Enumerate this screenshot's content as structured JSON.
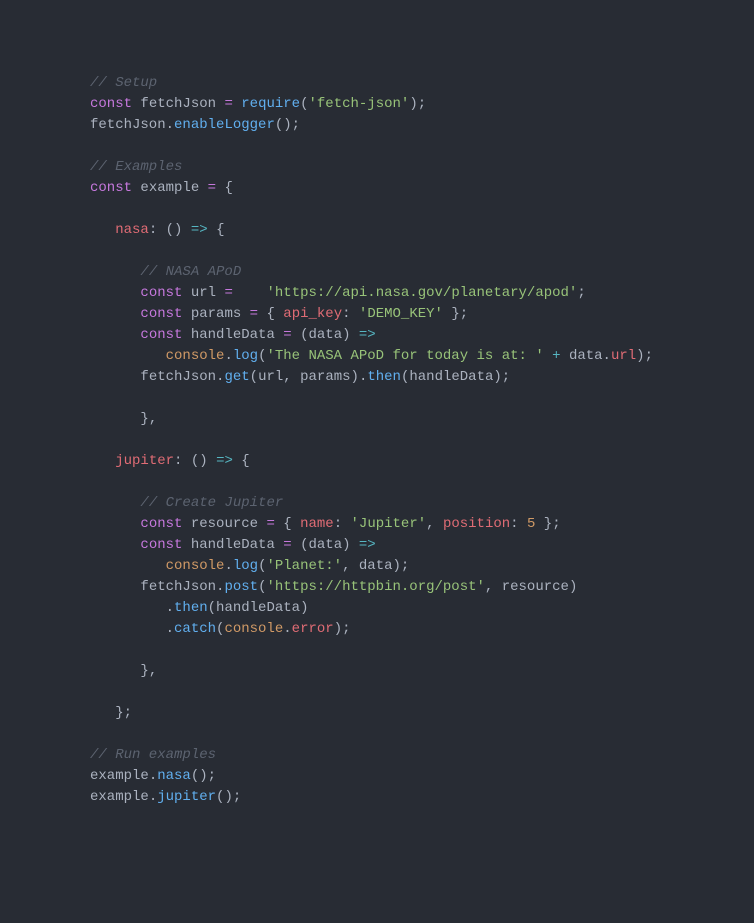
{
  "comments": {
    "setup": "// Setup",
    "examples": "// Examples",
    "nasa": "// NASA APoD",
    "jupiter": "// Create Jupiter",
    "run": "// Run examples"
  },
  "kw": {
    "const": "const",
    "arrow": "=>",
    "eq": "=",
    "plus": "+"
  },
  "ident": {
    "fetchJson": "fetchJson",
    "require": "require",
    "enableLogger": "enableLogger",
    "example": "example",
    "nasa": "nasa",
    "url": "url",
    "params": "params",
    "api_key": "api_key",
    "handleData": "handleData",
    "data": "data",
    "console": "console",
    "log": "log",
    "get": "get",
    "then": "then",
    "jupiter": "jupiter",
    "resource": "resource",
    "name": "name",
    "position": "position",
    "post": "post",
    "catch": "catch",
    "error": "error"
  },
  "str": {
    "fetch_json": "'fetch-json'",
    "apod_url": "'https://api.nasa.gov/planetary/apod'",
    "demo_key": "'DEMO_KEY'",
    "apod_msg": "'The NASA APoD for today is at: '",
    "jupiter_name": "'Jupiter'",
    "planet": "'Planet:'",
    "httpbin": "'https://httpbin.org/post'"
  },
  "num": {
    "five": "5"
  },
  "pun": {
    "lparen": "(",
    "rparen": ")",
    "lbrace": "{",
    "rbrace": "}",
    "semi": ";",
    "colon": ":",
    "comma": ",",
    "dot": ".",
    "space": " "
  }
}
